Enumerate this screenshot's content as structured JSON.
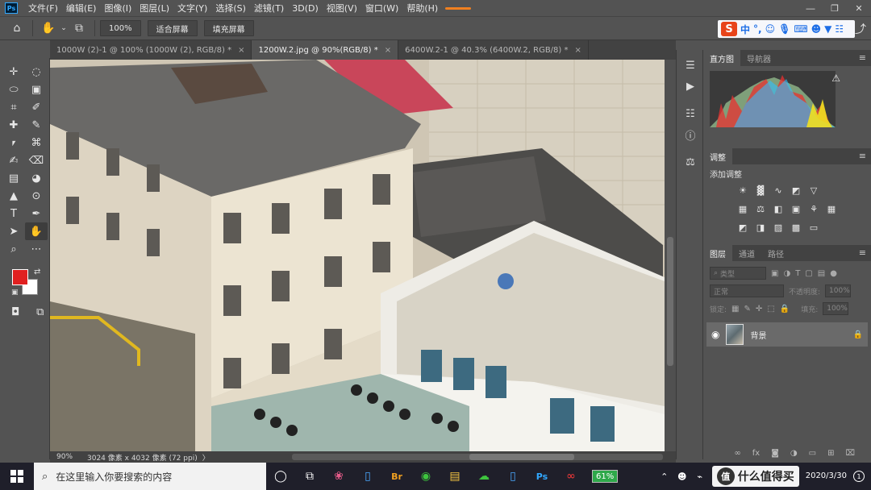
{
  "app": {
    "logo_text": "Ps"
  },
  "menu": {
    "items": [
      "文件(F)",
      "编辑(E)",
      "图像(I)",
      "图层(L)",
      "文字(Y)",
      "选择(S)",
      "滤镜(T)",
      "3D(D)",
      "视图(V)",
      "窗口(W)",
      "帮助(H)"
    ]
  },
  "options": {
    "zoom_value": "100%",
    "fit_screen": "适合屏幕",
    "fill_screen": "填充屏幕"
  },
  "ime": {
    "logo": "S",
    "lang": "中",
    "punct": "°,"
  },
  "tabs": [
    {
      "title": "1000W (2)-1 @ 100% (1000W (2), RGB/8) *",
      "active": false
    },
    {
      "title": "1200W.2.jpg @ 90%(RGB/8) *",
      "active": true
    },
    {
      "title": "6400W.2-1 @ 40.3% (6400W.2, RGB/8) *",
      "active": false
    }
  ],
  "tab_close": "×",
  "status": {
    "zoom": "90%",
    "doc_info": "3024 像素 x 4032 像素 (72 ppi)",
    "arrow": "〉"
  },
  "colors": {
    "foreground": "#e02020",
    "background": "#ffffff"
  },
  "panels": {
    "histogram": {
      "tab_active": "直方图",
      "tab_other": "导航器"
    },
    "adjustments": {
      "tab": "调整",
      "title": "添加调整"
    },
    "layers": {
      "tabs": [
        "图层",
        "通道",
        "路径"
      ],
      "filter_kind": "类型",
      "blend_mode": "正常",
      "opacity_label": "不透明度:",
      "opacity_value": "100%",
      "lock_label": "锁定:",
      "fill_label": "填充:",
      "fill_value": "100%",
      "layer_name": "背景"
    }
  },
  "taskbar": {
    "search_placeholder": "在这里输入你要搜索的内容",
    "battery": "61%",
    "watermark_text": "什么值得买",
    "watermark_logo": "值",
    "date": "2020/3/30",
    "notification_count": "1"
  }
}
